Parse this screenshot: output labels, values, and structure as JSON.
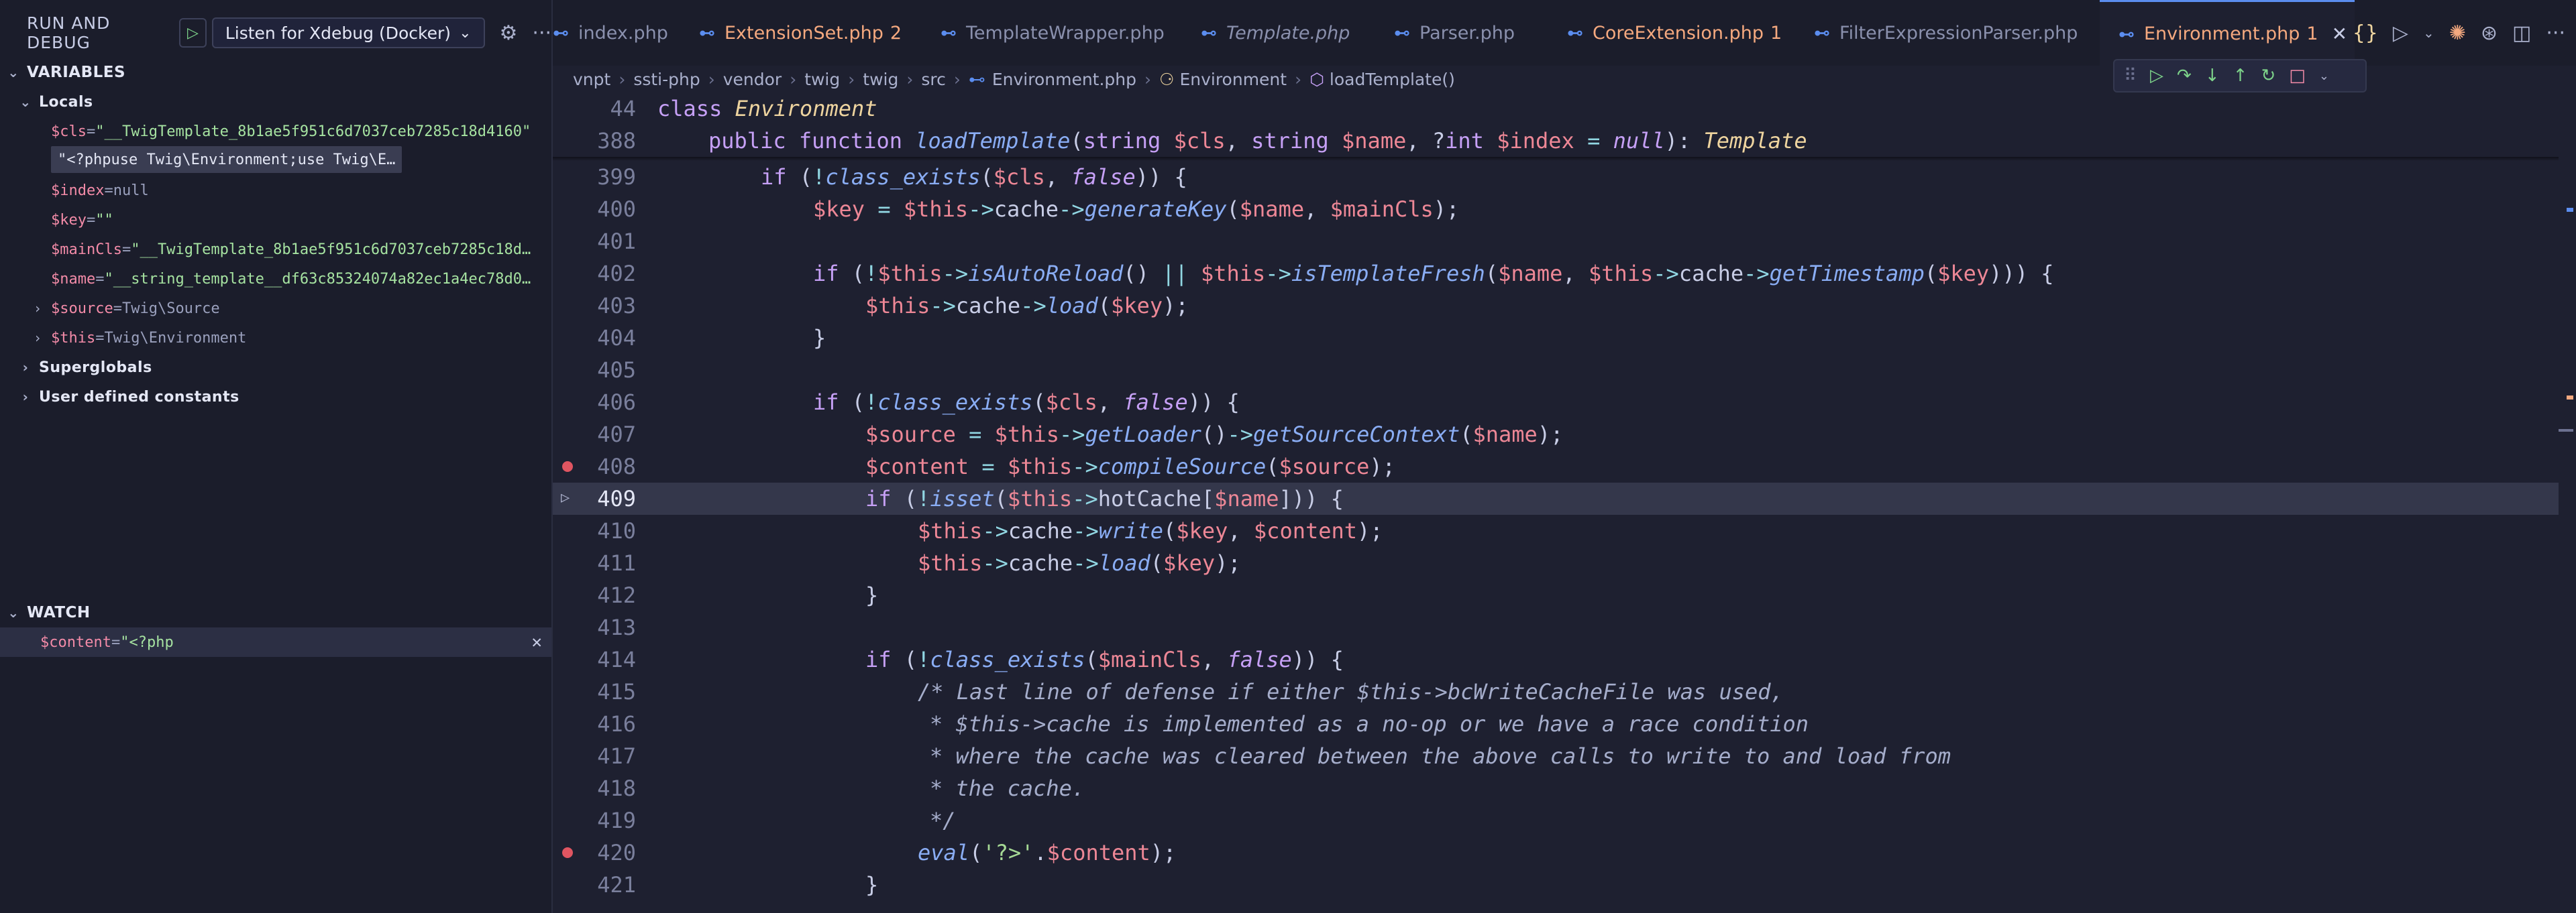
{
  "debug": {
    "title": "RUN AND DEBUG",
    "config": "Listen for Xdebug (Docker)"
  },
  "variables": {
    "header": "VARIABLES",
    "locals_label": "Locals",
    "items": [
      {
        "name": "$cls",
        "eq": " = ",
        "value": "\"__TwigTemplate_8b1ae5f951c6d7037ceb7285c18d4160\""
      },
      {
        "name": "$index",
        "eq": " = ",
        "value": "null"
      },
      {
        "name": "$key",
        "eq": " = ",
        "value": "\"\""
      },
      {
        "name": "$mainCls",
        "eq": " = ",
        "value": "\"__TwigTemplate_8b1ae5f951c6d7037ceb7285c18d…"
      },
      {
        "name": "$name",
        "eq": " = ",
        "value": "\"__string_template__df63c85324074a82ec1a4ec78d0…"
      },
      {
        "name": "$source",
        "eq": " = ",
        "value": "Twig\\Source"
      },
      {
        "name": "$this",
        "eq": " = ",
        "value": "Twig\\Environment"
      }
    ],
    "hover_tooltip": "\"<?phpuse Twig\\Environment;use Twig\\E…",
    "superglobals": "Superglobals",
    "constants": "User defined constants"
  },
  "watch": {
    "header": "WATCH",
    "expr": "$content",
    "eq": " = ",
    "value": "\"<?php"
  },
  "tabs": [
    {
      "label": "index.php",
      "badge": "",
      "modified": false,
      "italic": false,
      "active": false
    },
    {
      "label": "ExtensionSet.php",
      "badge": "2",
      "modified": true,
      "italic": false,
      "active": false
    },
    {
      "label": "TemplateWrapper.php",
      "badge": "",
      "modified": false,
      "italic": false,
      "active": false
    },
    {
      "label": "Template.php",
      "badge": "",
      "modified": false,
      "italic": true,
      "active": false
    },
    {
      "label": "Parser.php",
      "badge": "",
      "modified": false,
      "italic": false,
      "active": false
    },
    {
      "label": "CoreExtension.php",
      "badge": "1",
      "modified": true,
      "italic": false,
      "active": false
    },
    {
      "label": "FilterExpressionParser.php",
      "badge": "",
      "modified": false,
      "italic": false,
      "active": false
    },
    {
      "label": "Environment.php",
      "badge": "1",
      "modified": true,
      "italic": false,
      "active": true
    }
  ],
  "breadcrumb": {
    "parts": [
      "vnpt",
      "ssti-php",
      "vendor",
      "twig",
      "twig",
      "src"
    ],
    "file": "Environment.php",
    "class": "Environment",
    "method": "loadTemplate()"
  },
  "editor": {
    "sticky": [
      {
        "ln": "44",
        "text": "class Environment"
      },
      {
        "ln": "388",
        "text": "public function loadTemplate(string $cls, string $name, ?int $index = null): Template"
      }
    ],
    "lines": [
      {
        "ln": "399",
        "text": "if (!class_exists($cls, false)) {"
      },
      {
        "ln": "400",
        "text": "$key = $this->cache->generateKey($name, $mainCls);"
      },
      {
        "ln": "401",
        "text": ""
      },
      {
        "ln": "402",
        "text": "if (!$this->isAutoReload() || $this->isTemplateFresh($name, $this->cache->getTimestamp($key))) {"
      },
      {
        "ln": "403",
        "text": "$this->cache->load($key);"
      },
      {
        "ln": "404",
        "text": "}"
      },
      {
        "ln": "405",
        "text": ""
      },
      {
        "ln": "406",
        "text": "if (!class_exists($cls, false)) {"
      },
      {
        "ln": "407",
        "text": "$source = $this->getLoader()->getSourceContext($name);"
      },
      {
        "ln": "408",
        "text": "$content = $this->compileSource($source);"
      },
      {
        "ln": "409",
        "text": "if (!isset($this->hotCache[$name])) {"
      },
      {
        "ln": "410",
        "text": "$this->cache->write($key, $content);"
      },
      {
        "ln": "411",
        "text": "$this->cache->load($key);"
      },
      {
        "ln": "412",
        "text": "}"
      },
      {
        "ln": "413",
        "text": ""
      },
      {
        "ln": "414",
        "text": "if (!class_exists($mainCls, false)) {"
      },
      {
        "ln": "415",
        "text": "/* Last line of defense if either $this->bcWriteCacheFile was used,"
      },
      {
        "ln": "416",
        "text": "* $this->cache is implemented as a no-op or we have a race condition"
      },
      {
        "ln": "417",
        "text": "* where the cache was cleared between the above calls to write to and load from"
      },
      {
        "ln": "418",
        "text": "* the cache."
      },
      {
        "ln": "419",
        "text": "*/"
      },
      {
        "ln": "420",
        "text": "eval('?>'.$content);"
      },
      {
        "ln": "421",
        "text": "}"
      }
    ]
  },
  "colors": {
    "accent": "#5b8def",
    "breakpoint": "#e05561",
    "modified": "#f5a97f"
  }
}
